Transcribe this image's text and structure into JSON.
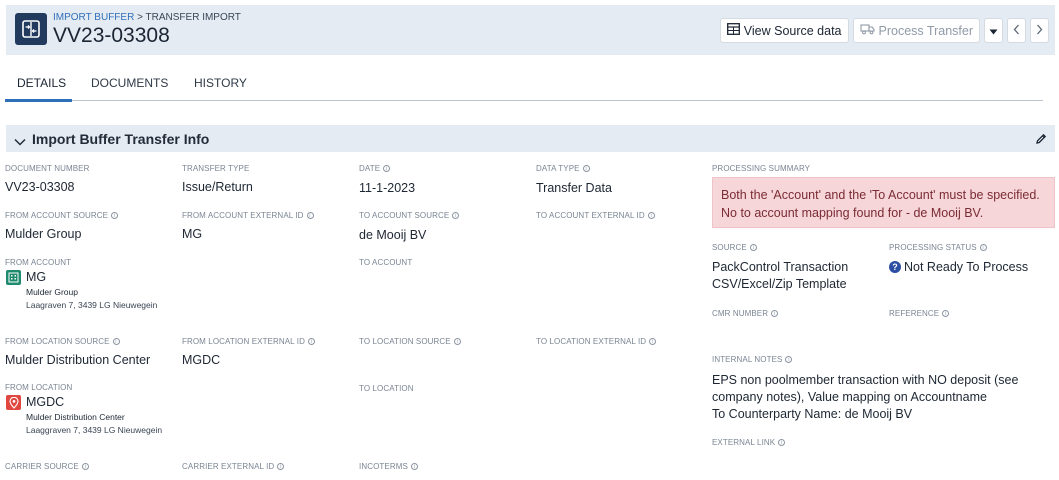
{
  "header": {
    "breadcrumb_link": "IMPORT BUFFER",
    "breadcrumb_sep": " > ",
    "breadcrumb_current": "TRANSFER IMPORT",
    "title": "VV23-03308",
    "app_icon": "transfer-icon"
  },
  "toolbar": {
    "view_source_label": "View Source data",
    "process_transfer_label": "Process Transfer"
  },
  "tabs": [
    {
      "label": "DETAILS",
      "active": true
    },
    {
      "label": "DOCUMENTS",
      "active": false
    },
    {
      "label": "HISTORY",
      "active": false
    }
  ],
  "section": {
    "title": "Import Buffer Transfer Info"
  },
  "fields": {
    "document_number": {
      "label": "DOCUMENT NUMBER",
      "value": "VV23-03308"
    },
    "transfer_type": {
      "label": "TRANSFER TYPE",
      "value": "Issue/Return"
    },
    "date": {
      "label": "DATE",
      "value": "11-1-2023"
    },
    "data_type": {
      "label": "DATA TYPE",
      "value": "Transfer Data"
    },
    "from_account_source": {
      "label": "FROM ACCOUNT SOURCE",
      "value": "Mulder Group"
    },
    "from_account_external_id": {
      "label": "FROM ACCOUNT EXTERNAL ID",
      "value": "MG"
    },
    "to_account_source": {
      "label": "TO ACCOUNT SOURCE",
      "value": "de Mooij BV"
    },
    "to_account_external_id": {
      "label": "TO ACCOUNT EXTERNAL ID",
      "value": ""
    },
    "from_account": {
      "label": "FROM ACCOUNT",
      "code": "MG",
      "name": "Mulder Group",
      "address": "Laagraven 7, 3439 LG Nieuwegein"
    },
    "to_account": {
      "label": "TO ACCOUNT",
      "value": ""
    },
    "from_location_source": {
      "label": "FROM LOCATION SOURCE",
      "value": "Mulder Distribution Center"
    },
    "from_location_external_id": {
      "label": "FROM LOCATION EXTERNAL ID",
      "value": "MGDC"
    },
    "to_location_source": {
      "label": "TO LOCATION SOURCE",
      "value": ""
    },
    "to_location_external_id": {
      "label": "TO LOCATION EXTERNAL ID",
      "value": ""
    },
    "from_location": {
      "label": "FROM LOCATION",
      "code": "MGDC",
      "name": "Mulder Distribution Center",
      "address": "Laaggraven 7, 3439 LG Nieuwegein"
    },
    "to_location": {
      "label": "TO LOCATION",
      "value": ""
    },
    "carrier_source": {
      "label": "CARRIER SOURCE",
      "value": ""
    },
    "carrier_external_id": {
      "label": "CARRIER EXTERNAL ID",
      "value": ""
    },
    "incoterms": {
      "label": "INCOTERMS",
      "value": ""
    }
  },
  "side": {
    "processing_summary": {
      "label": "PROCESSING SUMMARY",
      "line1": "Both the 'Account' and the 'To Account' must be specified.",
      "line2": "No to account mapping found for - de Mooij BV."
    },
    "source": {
      "label": "SOURCE",
      "line1": "PackControl Transaction",
      "line2": "CSV/Excel/Zip Template"
    },
    "processing_status": {
      "label": "PROCESSING STATUS",
      "value": "Not Ready To Process",
      "icon": "question-circle-icon"
    },
    "cmr_number": {
      "label": "CMR NUMBER",
      "value": ""
    },
    "reference": {
      "label": "REFERENCE",
      "value": ""
    },
    "internal_notes": {
      "label": "INTERNAL NOTES",
      "line1": "EPS non poolmember transaction with NO deposit (see",
      "line2": "company notes), Value mapping on Accountname",
      "line3": "To Counterparty Name: de Mooij BV"
    },
    "external_link": {
      "label": "EXTERNAL LINK",
      "value": ""
    }
  },
  "colors": {
    "accent": "#2e6fba",
    "header_bg": "#e4ebf3",
    "alert_bg": "#f7d6d9",
    "account_icon": "#1e8a6e",
    "location_icon": "#e0473f"
  }
}
